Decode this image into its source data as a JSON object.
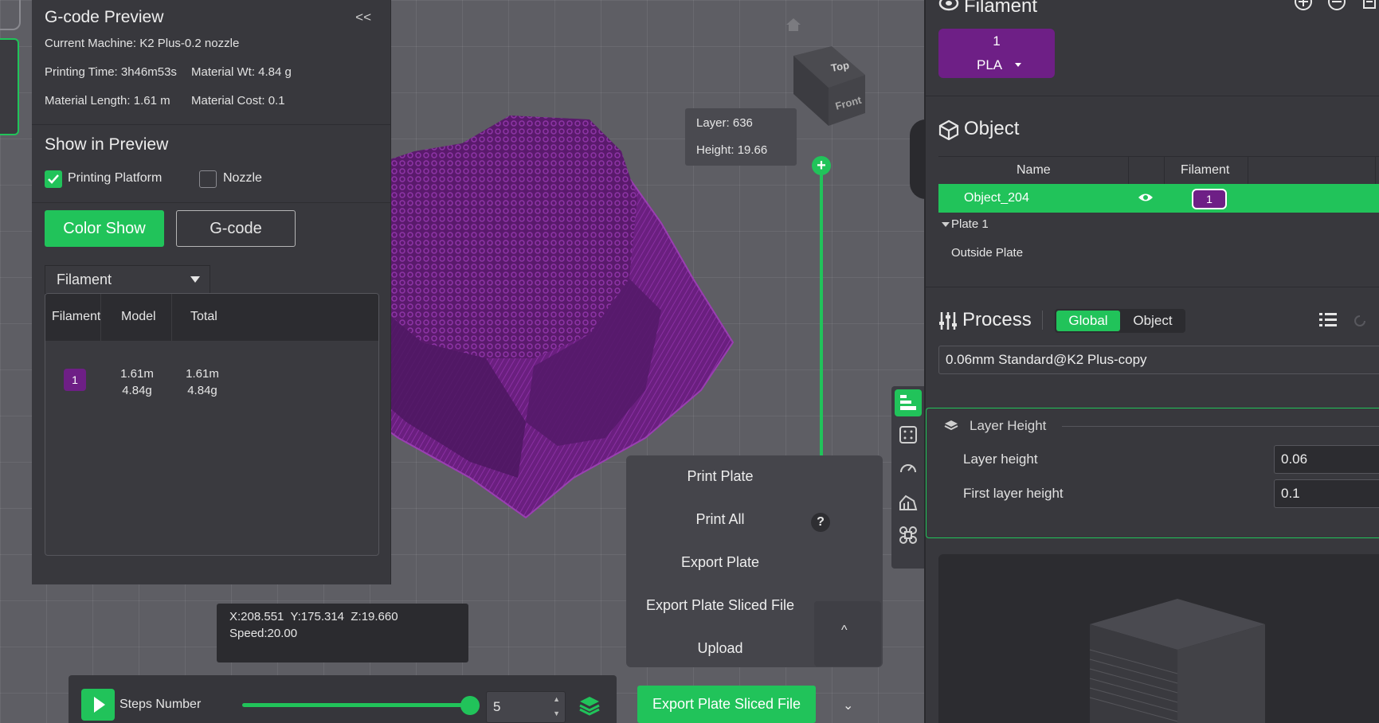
{
  "gcode_panel": {
    "title": "G-code Preview",
    "collapse": "<<",
    "machine": "Current Machine: K2 Plus-0.2 nozzle",
    "printing_time": "Printing Time: 3h46m53s",
    "material_wt": "Material Wt: 4.84 g",
    "material_length": "Material Length: 1.61 m",
    "material_cost": "Material Cost: 0.1",
    "show_in_preview": "Show in Preview",
    "printing_platform": {
      "label": "Printing Platform",
      "checked": true
    },
    "nozzle": {
      "label": "Nozzle",
      "checked": false
    },
    "color_show": "Color Show",
    "gcode": "G-code",
    "dropdown": "Filament",
    "table": {
      "headers": [
        "Filament",
        "Model",
        "Total"
      ],
      "rows": [
        {
          "filament": "1",
          "model_len": "1.61m",
          "model_wt": "4.84g",
          "total_len": "1.61m",
          "total_wt": "4.84g"
        }
      ]
    }
  },
  "viewport": {
    "layer_label": "Layer: 636",
    "height_label": "Height: 19.66",
    "cube_top": "Top",
    "cube_front": "Front",
    "coords": "X:208.551  Y:175.314  Z:19.660",
    "speed": "Speed:20.00"
  },
  "print_menu": {
    "items": [
      "Print Plate",
      "Print All",
      "Export Plate",
      "Export Plate Sliced File",
      "Upload"
    ],
    "help": "?",
    "expand": "^"
  },
  "bottom_bar": {
    "steps_label": "Steps Number",
    "steps_value": "5",
    "export_button": "Export Plate Sliced File",
    "export_caret": "⌄"
  },
  "sidebar": {
    "filament_title": "Filament",
    "filament_slot": {
      "number": "1",
      "type": "PLA"
    },
    "object_title": "Object",
    "object_table": {
      "headers": [
        "Name",
        "Filament"
      ],
      "selected": {
        "name": "Object_204",
        "filament": "1"
      },
      "tree": [
        "Plate 1",
        "Outside Plate"
      ]
    },
    "process_title": "Process",
    "process_tabs": [
      "Global",
      "Object"
    ],
    "preset": "0.06mm Standard@K2 Plus-copy",
    "group_title": "Layer Height",
    "params": [
      {
        "label": "Layer height",
        "value": "0.06"
      },
      {
        "label": "First layer height",
        "value": "0.1"
      }
    ]
  },
  "colors": {
    "accent": "#21c35a",
    "filament": "#6e1f86",
    "panel": "#38383d"
  }
}
